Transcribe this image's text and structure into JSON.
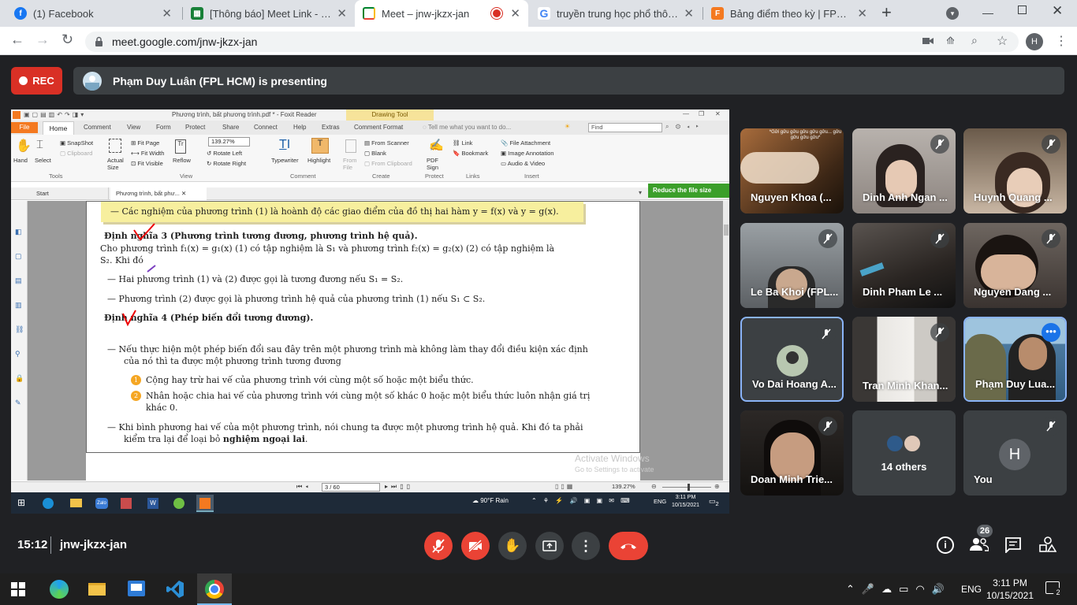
{
  "browser": {
    "tabs": [
      {
        "title": "(1) Facebook",
        "icon": "facebook-icon",
        "color": "#1877f2",
        "active": false
      },
      {
        "title": "[Thông báo] Meet Link - SV v",
        "icon": "sheets-icon",
        "color": "#188038",
        "active": false
      },
      {
        "title": "Meet – jnw-jkzx-jan",
        "icon": "meet-icon",
        "color": "#00832d",
        "active": true
      },
      {
        "title": "truyền trung học phổ thông g",
        "icon": "google-icon",
        "color": "#4285f4",
        "active": false
      },
      {
        "title": "Bảng điểm theo kỳ | FPT Poly",
        "icon": "fpt-icon",
        "color": "#f47920",
        "active": false
      }
    ],
    "new_tab": "+",
    "url": "meet.google.com/jnw-jkzx-jan",
    "profile_initial": "H"
  },
  "meet": {
    "rec_label": "REC",
    "presenting_text": "Phạm Duy Luân (FPL HCM) is presenting",
    "time": "15:12",
    "meeting_code": "jnw-jkzx-jan",
    "participant_count": "26",
    "accent_red": "#ea4335",
    "tiles": [
      {
        "name": "Nguyen Khoa (...",
        "muted": false,
        "bg": "#6b4a2e",
        "caption": "*Gửi gửu gửu gửu gửu gửu... gửu gửu gửu gửu*"
      },
      {
        "name": "Dinh Anh Ngan ...",
        "muted": true,
        "bg": "#a39c97"
      },
      {
        "name": "Huynh Quang ...",
        "muted": true,
        "bg": "#8c7865"
      },
      {
        "name": "Le Ba Khoi (FPL...",
        "muted": true,
        "bg": "#6f7478"
      },
      {
        "name": "Dinh Pham Le ...",
        "muted": true,
        "bg": "#3d3a38"
      },
      {
        "name": "Nguyen Dang ...",
        "muted": true,
        "bg": "#4e4641"
      },
      {
        "name": "Vo Dai Hoang A...",
        "muted": true,
        "bg": "#3c4043"
      },
      {
        "name": "Tran Minh Khan...",
        "muted": true,
        "bg": "#5a5653"
      },
      {
        "name": "Phạm Duy Lua...",
        "muted": false,
        "bg": "#5b7e95"
      },
      {
        "name": "Doan Minh Trie...",
        "muted": true,
        "bg": "#2d2b2a"
      },
      {
        "name": "14 others",
        "muted": false,
        "bg": "#3c4043"
      },
      {
        "name": "You",
        "muted": true,
        "bg": "#3c4043",
        "initial": "H"
      }
    ]
  },
  "foxit": {
    "title": "Phương trình, bất phương trình.pdf * - Foxit Reader",
    "drawing_tool": "Drawing Tool",
    "menu": [
      "File",
      "Home",
      "Comment",
      "View",
      "Form",
      "Protect",
      "Share",
      "Connect",
      "Help",
      "Extras",
      "Comment Format"
    ],
    "tell_me": "Tell me what you want to do...",
    "find": "Find",
    "ribbon": {
      "hand": "Hand",
      "select": "Select",
      "snapshot": "SnapShot",
      "clipboard": "Clipboard",
      "actual_size": "Actual Size",
      "fit_page": "Fit Page",
      "fit_width": "Fit Width",
      "fit_visible": "Fit Visible",
      "reflow": "Reflow",
      "zoom": "139.27%",
      "rotate_left": "Rotate Left",
      "rotate_right": "Rotate Right",
      "typewriter": "Typewriter",
      "highlight": "Highlight",
      "from_file": "From File",
      "from_scanner": "From Scanner",
      "blank": "Blank",
      "from_clipboard": "From Clipboard",
      "pdf_sign": "PDF Sign",
      "link": "Link",
      "bookmark": "Bookmark",
      "file_attachment": "File Attachment",
      "image_annotation": "Image Annotation",
      "audio_video": "Audio & Video",
      "groups": [
        "Tools",
        "View",
        "Comment",
        "Create",
        "Protect",
        "Links",
        "Insert"
      ]
    },
    "doc_tabs": [
      "Start",
      "Phương trình, bất phư..."
    ],
    "reduce": "Reduce the file size",
    "page_indicator": "3 / 60",
    "zoom_status": "139.27%",
    "activate_1": "Activate Windows",
    "activate_2": "Go to Settings to activate"
  },
  "pdf": {
    "highlight_line": "— Các nghiệm của phương trình (1) là hoành độ các giao điểm của đồ thị hai hàm y = f(x) và y = g(x).",
    "def3_title": "Định nghĩa 3 (Phương trình tương đương, phương trình hệ quả).",
    "def3_body_1": "Cho phương trình f₁(x) = g₁(x)  (1) có tập nghiệm là S₁ và phương trình f₂(x) = g₂(x)  (2) có tập nghiệm là",
    "def3_body_2": "S₂. Khi đó",
    "def3_item_1": "— Hai phương trình (1) và (2) được gọi là tương đương nếu S₁ = S₂.",
    "def3_item_2": "— Phương trình (2) được gọi là phương trình hệ quả của phương trình (1) nếu S₁ ⊂ S₂.",
    "def4_title": "Định nghĩa 4 (Phép biến đổi tương đương).",
    "def4_item_1a": "— Nếu thực hiện một phép biến đổi sau đây trên một phương trình mà không làm thay đổi điều kiện xác định",
    "def4_item_1b": "của nó thì ta được một phương trình tương đương",
    "sub_1": "Cộng hay trừ hai vế của phương trình với cùng một số hoặc một biểu thức.",
    "sub_2a": "Nhân hoặc chia hai vế của phương trình với cùng một số khác 0 hoặc một biểu thức luôn nhận giá trị",
    "sub_2b": "khác 0.",
    "last_1": "— Khi bình phương hai vế của một phương trình, nói chung ta được một phương trình hệ quả. Khi đó ta phải",
    "last_2a": "kiểm tra lại để loại bỏ ",
    "last_2b": "nghiệm ngoại lai",
    "last_2c": ".",
    "num_1": "1",
    "num_2": "2"
  },
  "inner_taskbar": {
    "weather": "90°F  Rain",
    "lang": "ENG",
    "time": "3:11 PM",
    "date": "10/15/2021",
    "notif": "2"
  },
  "taskbar": {
    "lang": "ENG",
    "time": "3:11 PM",
    "date": "10/15/2021",
    "notif": "2"
  }
}
